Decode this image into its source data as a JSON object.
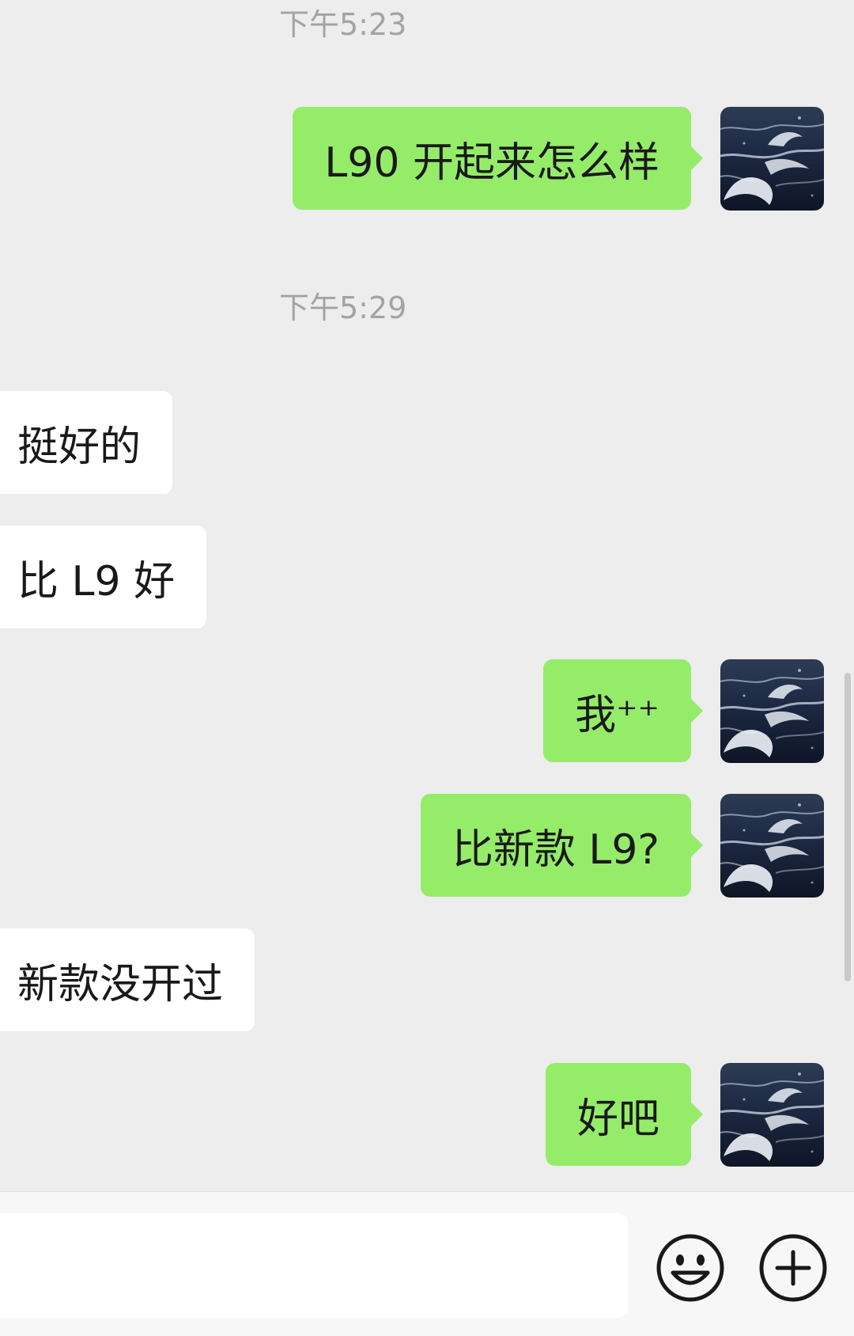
{
  "chat": {
    "timestamps": [
      "下午5:23",
      "下午5:29"
    ],
    "messages": [
      {
        "side": "out",
        "text": "L90 开起来怎么样"
      },
      {
        "side": "in",
        "text": "挺好的"
      },
      {
        "side": "in",
        "text": "比 L9 好"
      },
      {
        "side": "out",
        "text": "我⁺⁺"
      },
      {
        "side": "out",
        "text": "比新款 L9?"
      },
      {
        "side": "in",
        "text": "新款没开过"
      },
      {
        "side": "out",
        "text": "好吧"
      }
    ]
  },
  "composer": {
    "input_value": "",
    "emoji_icon": "smile-icon",
    "more_icon": "plus-circle-icon"
  },
  "colors": {
    "background": "#ededed",
    "outgoing_bubble": "#95ec69",
    "incoming_bubble": "#ffffff",
    "timestamp": "#a3a3a3"
  }
}
